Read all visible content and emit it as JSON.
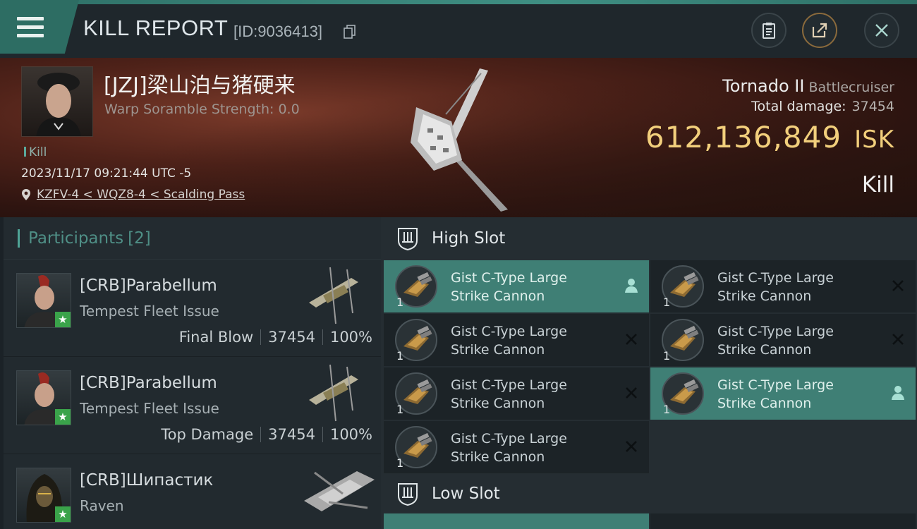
{
  "header": {
    "title": "KILL REPORT",
    "report_id": "[ID:9036413]"
  },
  "victim": {
    "name": "[JZJ]梁山泊与猪硬来",
    "warp_scramble": "Warp Soramble Strength: 0.0",
    "tag": "Kill",
    "datetime": "2023/11/17 09:21:44 UTC -5",
    "location": "KZFV-4 < WQZ8-4 < Scalding Pass",
    "ship_name": "Tornado II",
    "ship_class": "Battlecruiser",
    "total_damage_label": "Total damage:",
    "total_damage": "37454",
    "isk_value": "612,136,849",
    "isk_unit": "ISK",
    "result": "Kill"
  },
  "participants": {
    "label": "Participants",
    "count": "[2]",
    "rows": [
      {
        "name": "[CRB]Parabellum",
        "ship": "Tempest Fleet Issue",
        "role": "Final Blow",
        "damage": "37454",
        "percent": "100%"
      },
      {
        "name": "[CRB]Parabellum",
        "ship": "Tempest Fleet Issue",
        "role": "Top Damage",
        "damage": "37454",
        "percent": "100%"
      },
      {
        "name": "[CRB]Шипастик",
        "ship": "Raven"
      }
    ]
  },
  "fitting": {
    "high_slot_label": "High Slot",
    "low_slot_label": "Low Slot",
    "modules": [
      {
        "line1": "Gist C-Type Large",
        "line2": "Strike Cannon",
        "qty": "1",
        "state": "pilot"
      },
      {
        "line1": "Gist C-Type Large",
        "line2": "Strike Cannon",
        "qty": "1",
        "state": "destroyed"
      },
      {
        "line1": "Gist C-Type Large",
        "line2": "Strike Cannon",
        "qty": "1",
        "state": "destroyed"
      },
      {
        "line1": "Gist C-Type Large",
        "line2": "Strike Cannon",
        "qty": "1",
        "state": "destroyed"
      },
      {
        "line1": "Gist C-Type Large",
        "line2": "Strike Cannon",
        "qty": "1",
        "state": "destroyed"
      },
      {
        "line1": "Gist C-Type Large",
        "line2": "Strike Cannon",
        "qty": "1",
        "state": "pilot"
      },
      {
        "line1": "Gist C-Type Large",
        "line2": "Strike Cannon",
        "qty": "1",
        "state": "destroyed"
      }
    ]
  },
  "colors": {
    "accent_teal": "#3f7f75",
    "isk_gold": "#f2cf7c",
    "final_blow_star": "#3aa34a"
  }
}
